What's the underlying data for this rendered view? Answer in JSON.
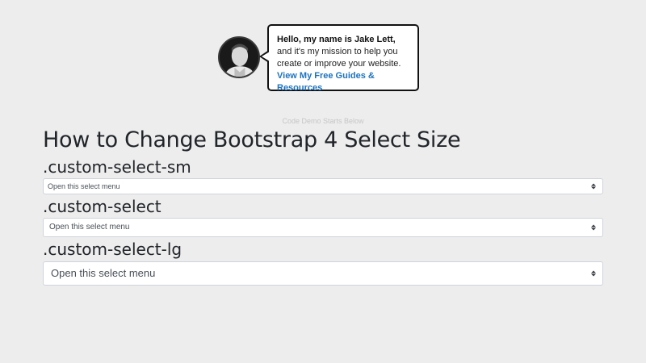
{
  "promo": {
    "greeting": "Hello, my name is Jake Lett,",
    "text": " and it's my mission to help you create or improve your website. ",
    "link": "View My Free Guides & Resources"
  },
  "demo_note": "Code Demo Starts Below",
  "main": {
    "title": "How to Change Bootstrap 4 Select Size",
    "sections": [
      {
        "heading": ".custom-select-sm",
        "select_value": "Open this select menu"
      },
      {
        "heading": ".custom-select",
        "select_value": "Open this select menu"
      },
      {
        "heading": ".custom-select-lg",
        "select_value": "Open this select menu"
      }
    ]
  }
}
